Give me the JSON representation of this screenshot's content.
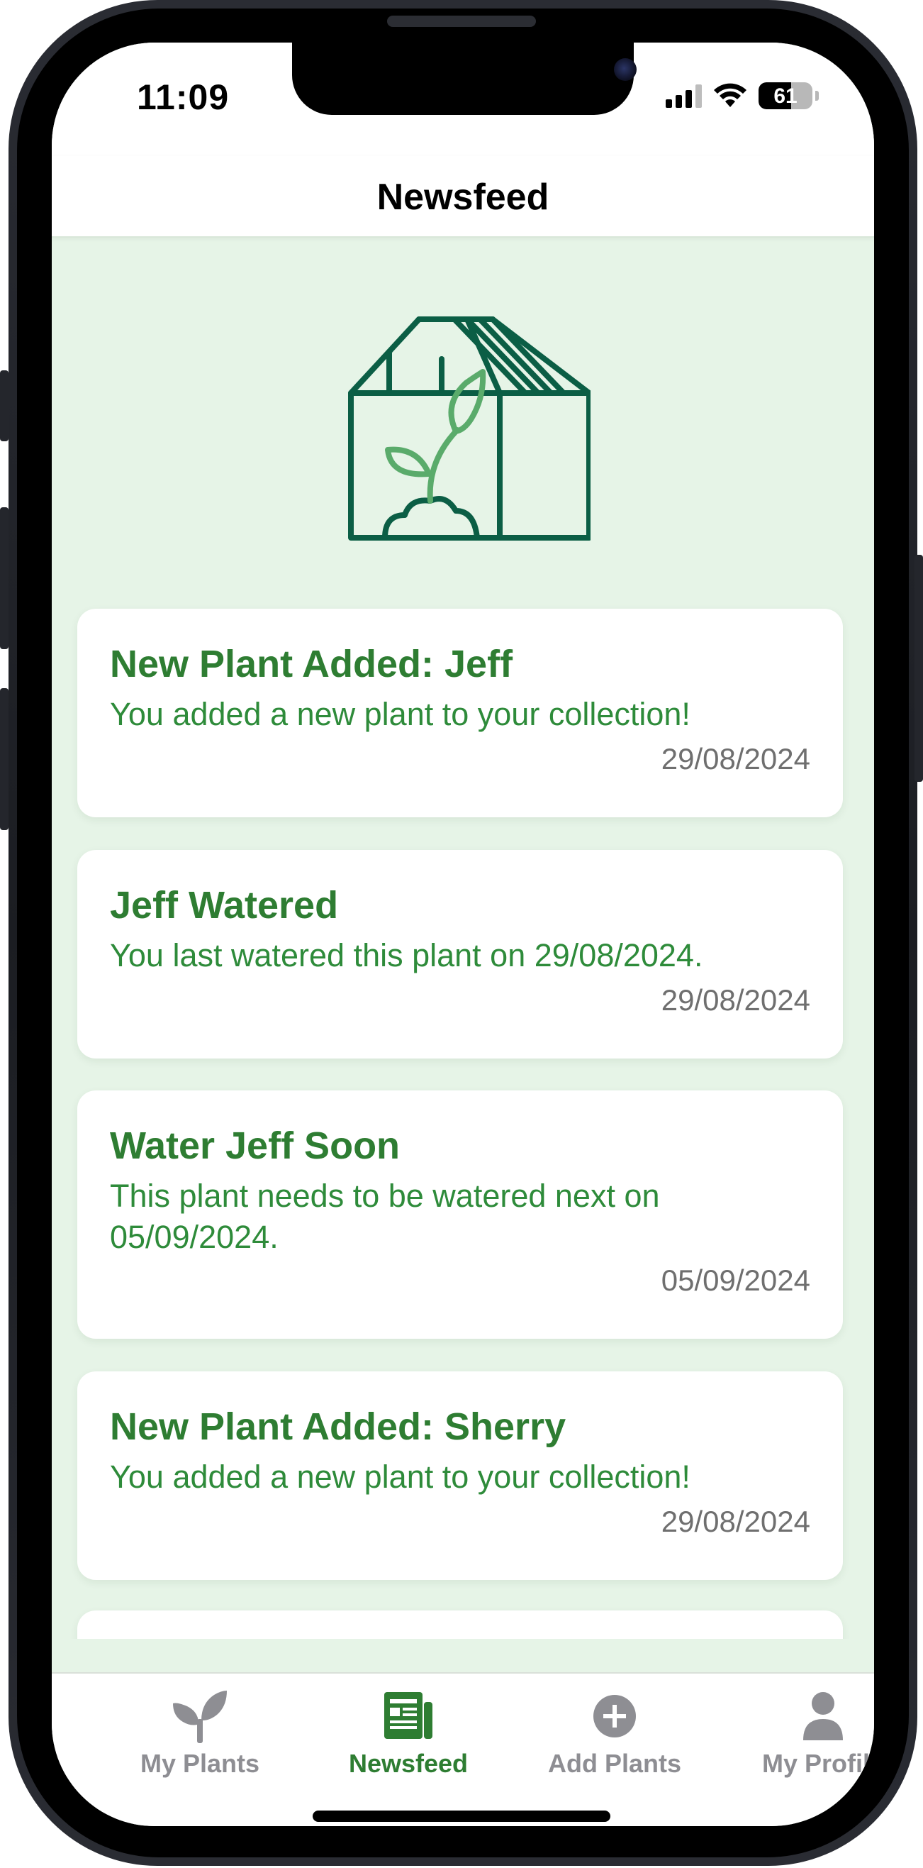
{
  "status_bar": {
    "time": "11:09",
    "battery_level": "61"
  },
  "header": {
    "title": "Newsfeed"
  },
  "hero": {
    "icon": "greenhouse-with-sprout-icon"
  },
  "feed": [
    {
      "title": "New Plant Added: Jeff",
      "body": "You added a new plant to your collection!",
      "date": "29/08/2024"
    },
    {
      "title": "Jeff Watered",
      "body": "You last watered this plant on 29/08/2024.",
      "date": "29/08/2024"
    },
    {
      "title": "Water Jeff Soon",
      "body": "This plant needs to be watered next on 05/09/2024.",
      "date": "05/09/2024"
    },
    {
      "title": "New Plant Added: Sherry",
      "body": "You added a new plant to your collection!",
      "date": "29/08/2024"
    }
  ],
  "tabs": [
    {
      "label": "My Plants",
      "icon": "sprout-icon",
      "active": false
    },
    {
      "label": "Newsfeed",
      "icon": "newspaper-icon",
      "active": true
    },
    {
      "label": "Add Plants",
      "icon": "plus-circle-icon",
      "active": false
    },
    {
      "label": "My Profile",
      "icon": "person-icon",
      "active": false
    }
  ],
  "colors": {
    "background": "#e6f4e7",
    "accent": "#2e7d32",
    "icon_dark": "#0b5e45",
    "icon_light": "#5aab6b",
    "inactive_tab": "#8e8e93"
  }
}
